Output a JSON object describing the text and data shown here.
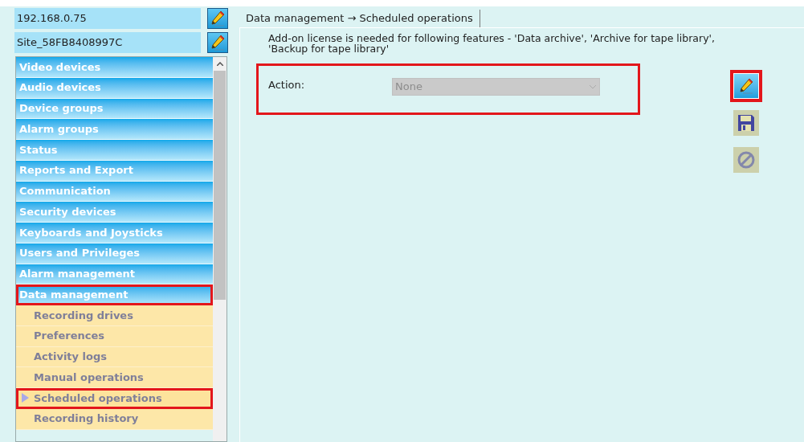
{
  "header_fields": [
    {
      "value": "192.168.0.75"
    },
    {
      "value": "Site_58FB8408997C"
    }
  ],
  "nav": [
    {
      "label": "Video devices",
      "highlighted": false
    },
    {
      "label": "Audio devices",
      "highlighted": false
    },
    {
      "label": "Device groups",
      "highlighted": false
    },
    {
      "label": "Alarm groups",
      "highlighted": false
    },
    {
      "label": "Status",
      "highlighted": false
    },
    {
      "label": "Reports and Export",
      "highlighted": false
    },
    {
      "label": "Communication",
      "highlighted": false
    },
    {
      "label": "Security devices",
      "highlighted": false
    },
    {
      "label": "Keyboards and Joysticks",
      "highlighted": false
    },
    {
      "label": "Users and Privileges",
      "highlighted": false
    },
    {
      "label": "Alarm management",
      "highlighted": false
    },
    {
      "label": "Data management",
      "highlighted": true,
      "children": [
        {
          "label": "Recording drives",
          "selected": false,
          "highlighted": false
        },
        {
          "label": "Preferences",
          "selected": false,
          "highlighted": false
        },
        {
          "label": "Activity logs",
          "selected": false,
          "highlighted": false
        },
        {
          "label": "Manual operations",
          "selected": false,
          "highlighted": false
        },
        {
          "label": "Scheduled operations",
          "selected": true,
          "highlighted": true
        },
        {
          "label": "Recording history",
          "selected": false,
          "highlighted": false
        }
      ]
    }
  ],
  "tab": {
    "label": "Data management → Scheduled operations"
  },
  "notice": "Add-on license is needed for following features - 'Data archive', 'Archive for tape library', 'Backup for tape library'",
  "action": {
    "label": "Action:",
    "value": "None",
    "disabled": true,
    "highlighted": true
  },
  "tools": [
    {
      "kind": "edit",
      "disabled": false,
      "highlighted": true
    },
    {
      "kind": "save",
      "disabled": true,
      "highlighted": false
    },
    {
      "kind": "cancel",
      "disabled": true,
      "highlighted": false
    }
  ]
}
